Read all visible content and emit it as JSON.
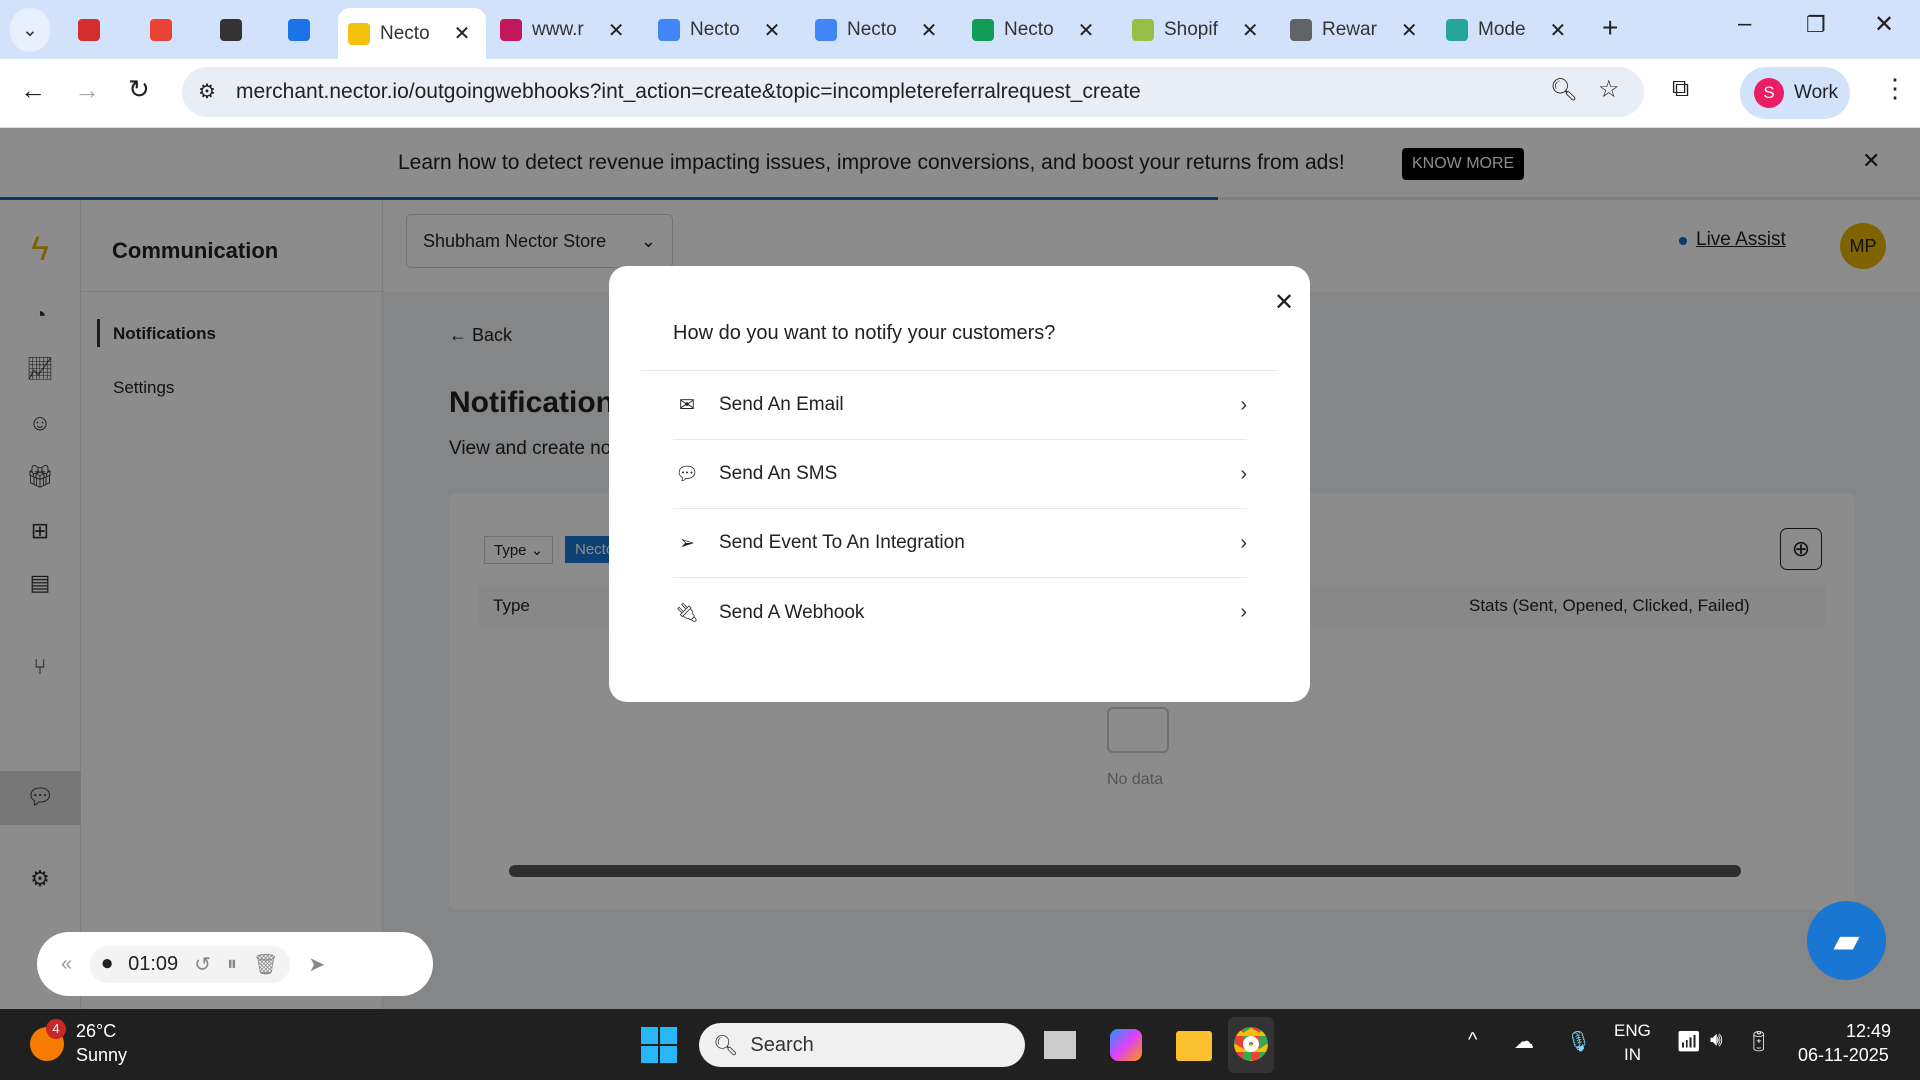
{
  "browser": {
    "tabs": [
      {
        "label": "",
        "icon": "recording-icon",
        "color": "#d32f2f"
      },
      {
        "label": "",
        "icon": "gmail-icon",
        "color": "#ea4335"
      },
      {
        "label": "",
        "icon": "chatgpt-icon",
        "color": "#333333"
      },
      {
        "label": "",
        "icon": "calendar-icon",
        "color": "#1a73e8"
      },
      {
        "label": "Necto",
        "icon": "nector-bolt-icon",
        "color": "#f4c20d",
        "active": true
      },
      {
        "label": "www.r",
        "icon": "maze-icon",
        "color": "#c2185b"
      },
      {
        "label": "Necto",
        "icon": "docs-icon",
        "color": "#4285f4"
      },
      {
        "label": "Necto",
        "icon": "docs-icon",
        "color": "#4285f4"
      },
      {
        "label": "Necto",
        "icon": "sheets-icon",
        "color": "#0f9d58"
      },
      {
        "label": "Shopif",
        "icon": "shopify-icon",
        "color": "#95bf47"
      },
      {
        "label": "Rewar",
        "icon": "globe-icon",
        "color": "#5f6368"
      },
      {
        "label": "Mode",
        "icon": "shopify-icon",
        "color": "#26a69a"
      }
    ],
    "url": "merchant.nector.io/outgoingwebhooks?int_action=create&topic=incompletereferralrequest_create",
    "profile_initial": "S",
    "profile_label": "Work"
  },
  "banner": {
    "text": "Learn how to detect revenue impacting issues, improve conversions, and boost your returns from ads!",
    "button": "KNOW MORE"
  },
  "sidebar": {
    "title": "Communication",
    "items": [
      "Notifications",
      "Settings"
    ]
  },
  "header": {
    "store": "Shubham Nector Store",
    "live_assist": "Live Assist",
    "avatar": "MP"
  },
  "main": {
    "back": "Back",
    "title": "Notifications",
    "description": "View and create notifications for emails, sms, integrations and webhooks.",
    "filter_type": "Type",
    "filter_chip": "Nector",
    "col_type": "Type",
    "col_stats": "Stats (Sent, Opened, Clicked, Failed)",
    "empty": "No data"
  },
  "modal": {
    "title": "How do you want to notify your customers?",
    "options": [
      "Send An Email",
      "Send An SMS",
      "Send Event To An Integration",
      "Send A Webhook"
    ]
  },
  "recorder": {
    "time": "01:09"
  },
  "taskbar": {
    "weather_badge": "4",
    "temp": "26°C",
    "condition": "Sunny",
    "search": "Search",
    "lang1": "ENG",
    "lang2": "IN",
    "time": "12:49",
    "date": "06-11-2025"
  }
}
